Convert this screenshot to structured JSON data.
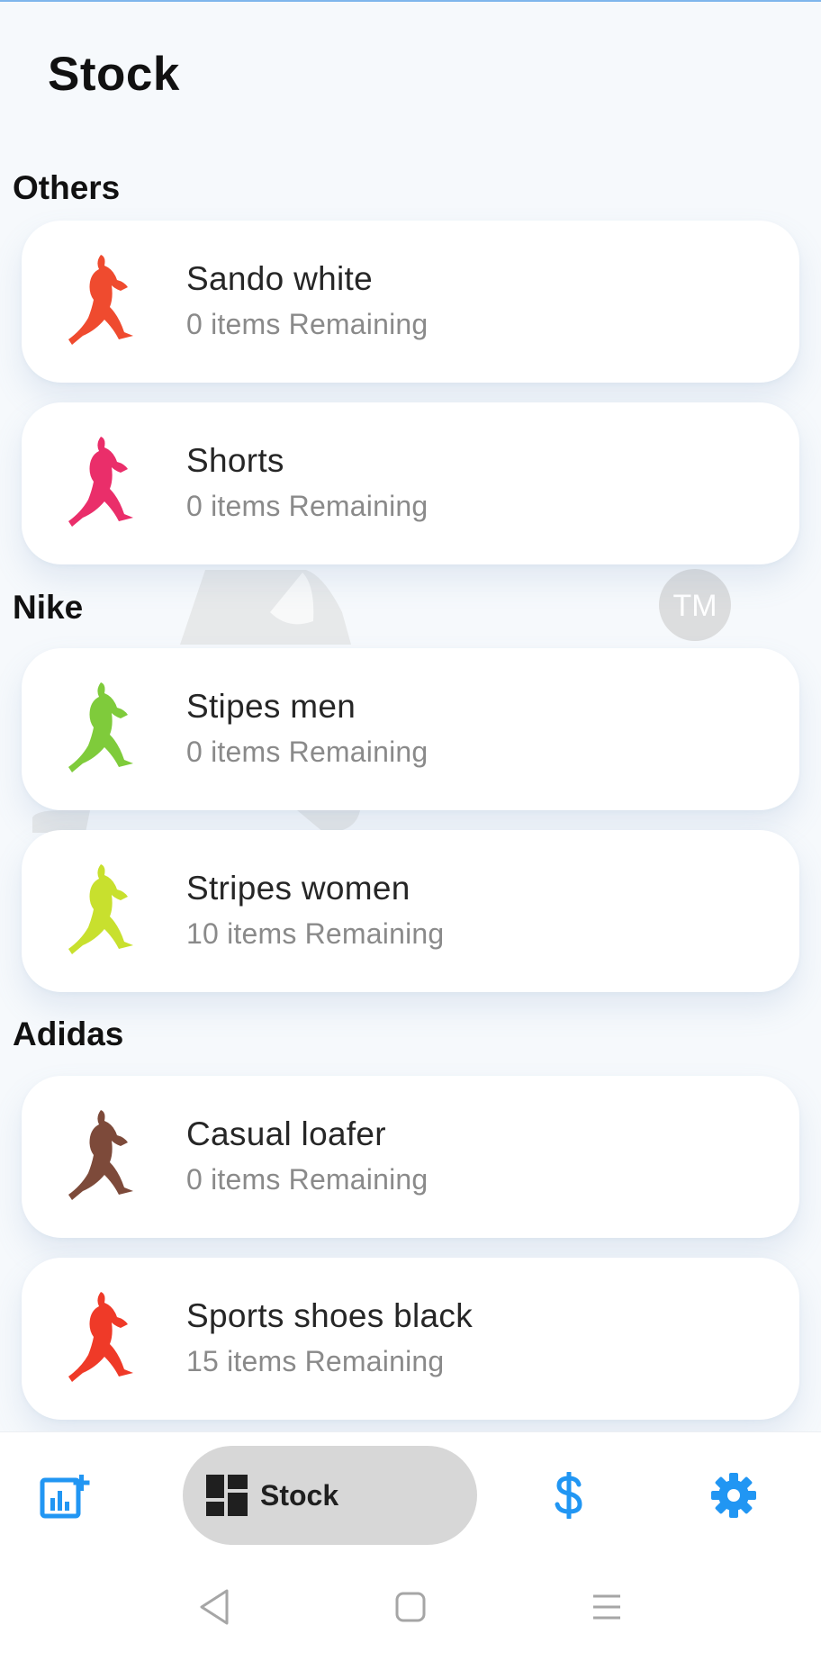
{
  "page": {
    "title": "Stock"
  },
  "sections": [
    {
      "name": "Others",
      "items": [
        {
          "name": "Sando white",
          "remaining": "0 items Remaining",
          "color": "#ef4b2f"
        },
        {
          "name": "Shorts",
          "remaining": "0 items Remaining",
          "color": "#ea2e6a"
        }
      ]
    },
    {
      "name": "Nike",
      "items": [
        {
          "name": "Stipes men",
          "remaining": "0 items Remaining",
          "color": "#7fcb3b"
        },
        {
          "name": "Stripes women",
          "remaining": "10 items Remaining",
          "color": "#c8e02e"
        }
      ]
    },
    {
      "name": "Adidas",
      "items": [
        {
          "name": "Casual loafer",
          "remaining": "0 items Remaining",
          "color": "#7d4a3a"
        },
        {
          "name": "Sports shoes black",
          "remaining": "15 items Remaining",
          "color": "#ef3a28"
        }
      ]
    }
  ],
  "watermark": {
    "text": "TM"
  },
  "bottom_nav": {
    "items": [
      {
        "icon": "add-chart-icon",
        "label": ""
      },
      {
        "icon": "dashboard-icon",
        "label": "Stock",
        "active": true
      },
      {
        "icon": "dollar-icon",
        "label": ""
      },
      {
        "icon": "settings-icon",
        "label": ""
      }
    ],
    "accent": "#2196f3"
  },
  "system_nav": {
    "icons": [
      "back-icon",
      "home-icon",
      "recents-icon"
    ]
  }
}
